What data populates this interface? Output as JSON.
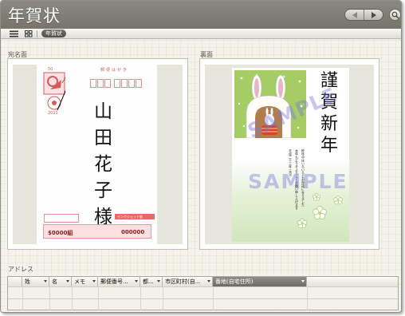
{
  "window": {
    "title": "年賀状"
  },
  "toolbar": {
    "tab_label": "年賀状"
  },
  "panels": {
    "front_label": "宛名面",
    "back_label": "裏面"
  },
  "postcard": {
    "header_text": "郵便はがき",
    "recipient_name": [
      "山",
      "田",
      "花",
      "子",
      "様"
    ],
    "stamp_year": "2011",
    "stamp_value": "50",
    "lottery_left": "$0000組",
    "lottery_right": "000000",
    "footer_tag": "インクジェット紙"
  },
  "nengajo": {
    "greeting": [
      "謹",
      "賀",
      "新",
      "年"
    ],
    "watermark": "SAMPLE",
    "message_lines": [
      "昨年中はいろいろとお世話になりました",
      "本年もどうぞよろしくお願い申し上げます",
      "平成二十三年 元旦"
    ],
    "colors": {
      "green": "#a6cd65",
      "rabbit_red": "#d9442b"
    }
  },
  "address": {
    "section_label": "アドレス",
    "columns": [
      "姓",
      "名",
      "メモ",
      "郵便番号...",
      "都...",
      "市区町村(自...",
      "番地(自宅住所)"
    ],
    "active_column": "番地(自宅住所)"
  },
  "icons": {
    "nav_back": "chevron-left-icon",
    "nav_forward": "chevron-right-icon",
    "search": "search-icon",
    "list_view": "list-view-icon",
    "grid_view": "grid-view-icon"
  }
}
